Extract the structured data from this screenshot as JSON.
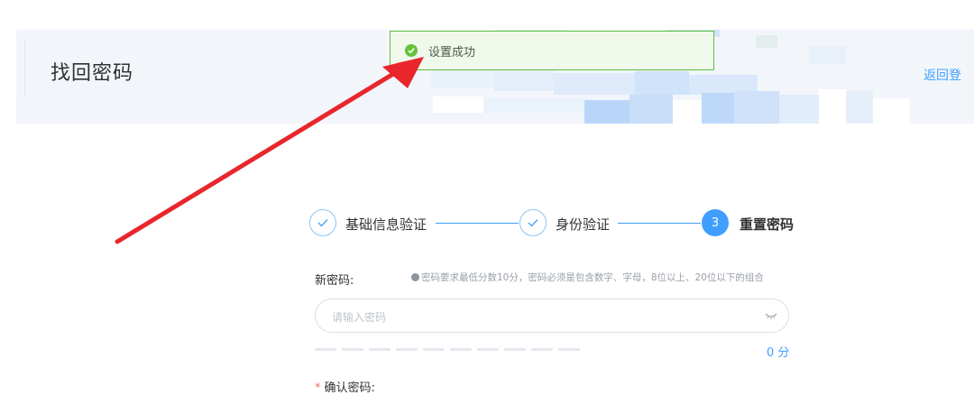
{
  "header": {
    "title": "找回密码",
    "back_link": "返回登"
  },
  "toast": {
    "message": "设置成功",
    "icon": "check-circle-icon",
    "color": "#67c23a"
  },
  "steps": [
    {
      "label": "基础信息验证",
      "status": "done"
    },
    {
      "label": "身份验证",
      "status": "done"
    },
    {
      "label": "重置密码",
      "status": "active",
      "number": "3"
    }
  ],
  "form": {
    "new_password_label": "新密码:",
    "hint": "密码要求最低分数10分，密码必须是包含数字、字母，8位以上、20位以下的组合",
    "password_placeholder": "请输入密码",
    "password_value": "",
    "strength_score": "0 分",
    "strength_level": 0,
    "confirm_label": "确认密码:",
    "required_mark": "*"
  },
  "colors": {
    "primary": "#409eff",
    "success": "#67c23a",
    "danger": "#f56c6c"
  }
}
